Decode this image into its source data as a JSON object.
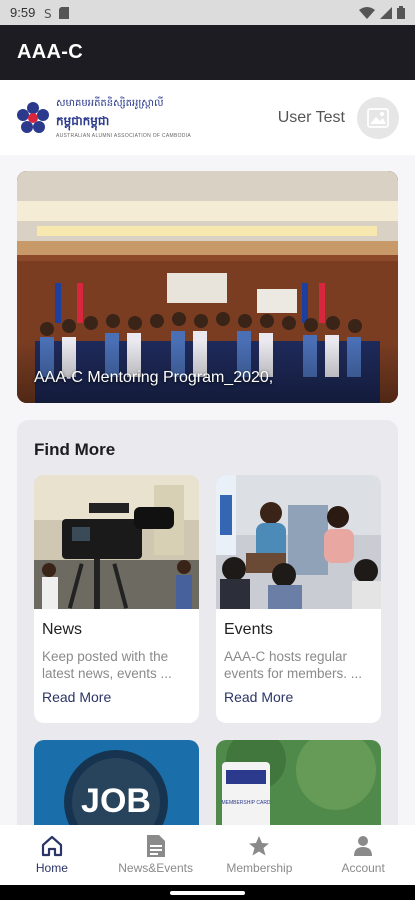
{
  "status_bar": {
    "time": "9:59"
  },
  "app_bar": {
    "title": "AAA-C"
  },
  "header": {
    "logo": {
      "line1": "សមាគមអតីតនិស្សិតអូស្ត្រាលី",
      "line2": "កម្ពុជាកម្ពុជា",
      "line3": "AUSTRALIAN ALUMNI ASSOCIATION OF CAMBODIA"
    },
    "user_name": "User Test"
  },
  "hero": {
    "caption": "AAA-C Mentoring Program_2020,"
  },
  "find_more": {
    "title": "Find More",
    "cards": [
      {
        "title": "News",
        "description": "Keep posted with the latest news, events ...",
        "link": "Read More"
      },
      {
        "title": "Events",
        "description": "AAA-C hosts regular events for members. ...",
        "link": "Read More"
      },
      {
        "badge": "JOB"
      },
      {
        "card_text": "MEMBERSHIP CARD"
      }
    ]
  },
  "bottom_nav": [
    {
      "label": "Home",
      "icon": "home-icon",
      "active": true
    },
    {
      "label": "News&Events",
      "icon": "document-icon",
      "active": false
    },
    {
      "label": "Membership",
      "icon": "star-icon",
      "active": false
    },
    {
      "label": "Account",
      "icon": "person-icon",
      "active": false
    }
  ],
  "colors": {
    "app_bar": "#1d1c22",
    "accent": "#2b3566",
    "panel": "#e9e9ee",
    "background": "#f6f6f8"
  }
}
